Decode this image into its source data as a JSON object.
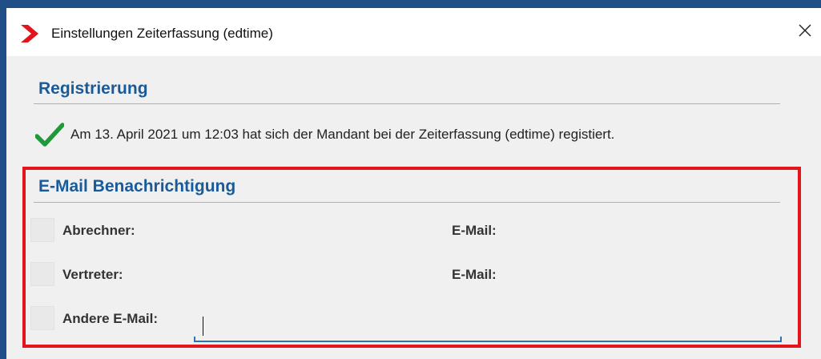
{
  "window": {
    "title": "Einstellungen Zeiterfassung (edtime)",
    "close_symbol": "✕",
    "logo_icon": "red-chevron-icon"
  },
  "registration": {
    "heading": "Registrierung",
    "status_text": "Am 13. April 2021 um 12:03 hat sich der Mandant bei der Zeiterfassung (edtime) registiert.",
    "status_icon": "checkmark-icon"
  },
  "notification": {
    "heading": "E-Mail Benachrichtigung",
    "rows": [
      {
        "checkbox_label": "Abrechner:",
        "email_label": "E-Mail:",
        "checked": false
      },
      {
        "checkbox_label": "Vertreter:",
        "email_label": "E-Mail:",
        "checked": false
      },
      {
        "checkbox_label": "Andere E-Mail:",
        "checked": false
      }
    ],
    "other_email_value": "",
    "other_email_placeholder": ""
  },
  "colors": {
    "frame": "#1f4f86",
    "heading": "#1a5a98",
    "highlight": "#e3141b",
    "check": "#1f9a3a",
    "input_underline": "#2a73b8"
  }
}
